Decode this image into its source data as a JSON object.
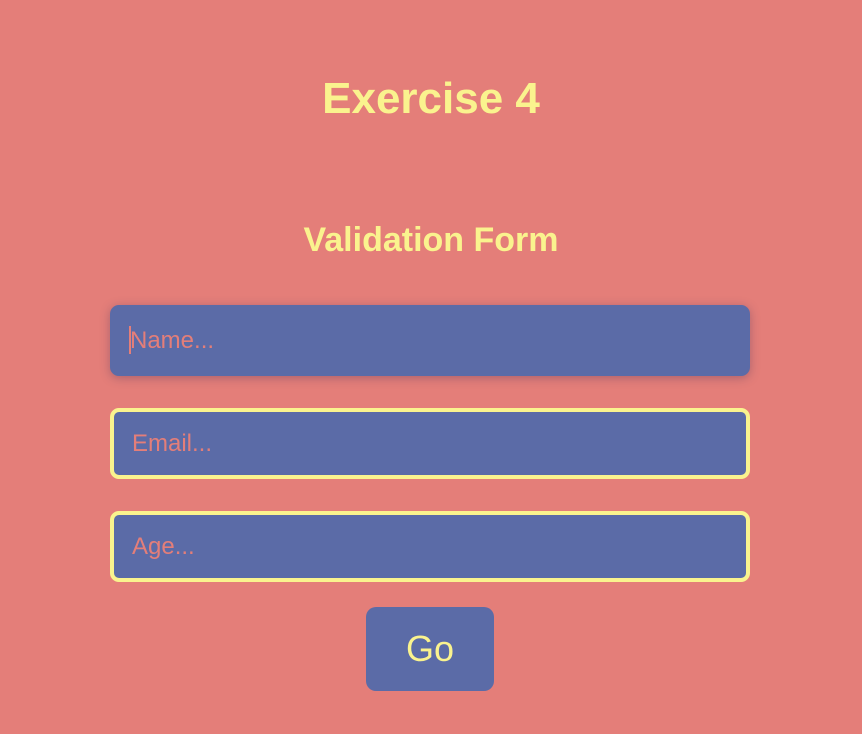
{
  "header": {
    "title": "Exercise 4"
  },
  "form": {
    "heading": "Validation Form",
    "fields": [
      {
        "placeholder": "Name...",
        "value": ""
      },
      {
        "placeholder": "Email...",
        "value": ""
      },
      {
        "placeholder": "Age...",
        "value": ""
      }
    ],
    "submit_label": "Go"
  },
  "colors": {
    "background": "#e47e79",
    "accent": "#faf38e",
    "field": "#5b6ba7"
  }
}
